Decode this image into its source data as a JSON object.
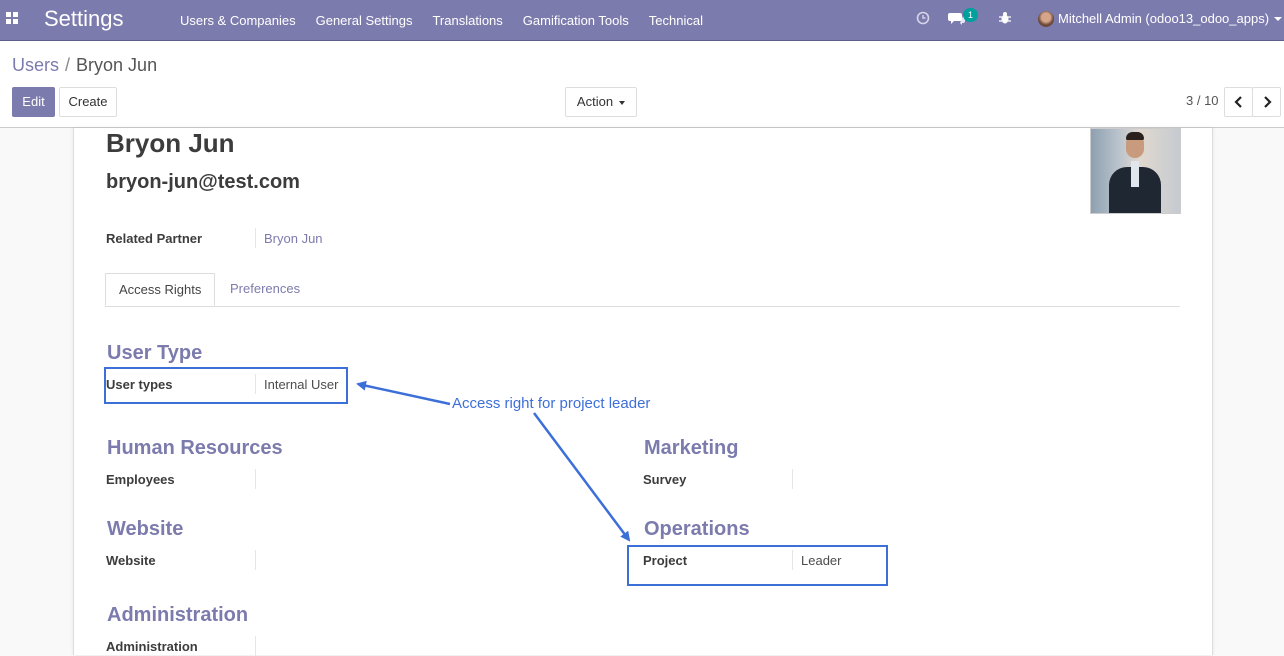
{
  "navbar": {
    "brand": "Settings",
    "menu": [
      "Users & Companies",
      "General Settings",
      "Translations",
      "Gamification Tools",
      "Technical"
    ],
    "badge_count": "1",
    "user": "Mitchell Admin (odoo13_odoo_apps)"
  },
  "breadcrumb": {
    "parent": "Users",
    "separator": "/",
    "current": "Bryon Jun"
  },
  "buttons": {
    "edit": "Edit",
    "create": "Create",
    "action": "Action"
  },
  "pager": {
    "value": "3 / 10"
  },
  "record": {
    "name": "Bryon Jun",
    "email": "bryon-jun@test.com",
    "related_partner_label": "Related Partner",
    "related_partner_value": "Bryon Jun"
  },
  "tabs": [
    "Access Rights",
    "Preferences"
  ],
  "groups": {
    "user_type": {
      "title": "User Type",
      "label": "User types",
      "value": "Internal User"
    },
    "human_resources": {
      "title": "Human Resources",
      "label": "Employees",
      "value": ""
    },
    "marketing": {
      "title": "Marketing",
      "label": "Survey",
      "value": ""
    },
    "website": {
      "title": "Website",
      "label": "Website",
      "value": ""
    },
    "operations": {
      "title": "Operations",
      "label": "Project",
      "value": "Leader"
    },
    "administration": {
      "title": "Administration",
      "label": "Administration",
      "value": ""
    }
  },
  "annotation": {
    "text": "Access right for project leader",
    "color": "#3d6fd9"
  },
  "colors": {
    "brand": "#7c7bad",
    "badge": "#00a09d"
  }
}
